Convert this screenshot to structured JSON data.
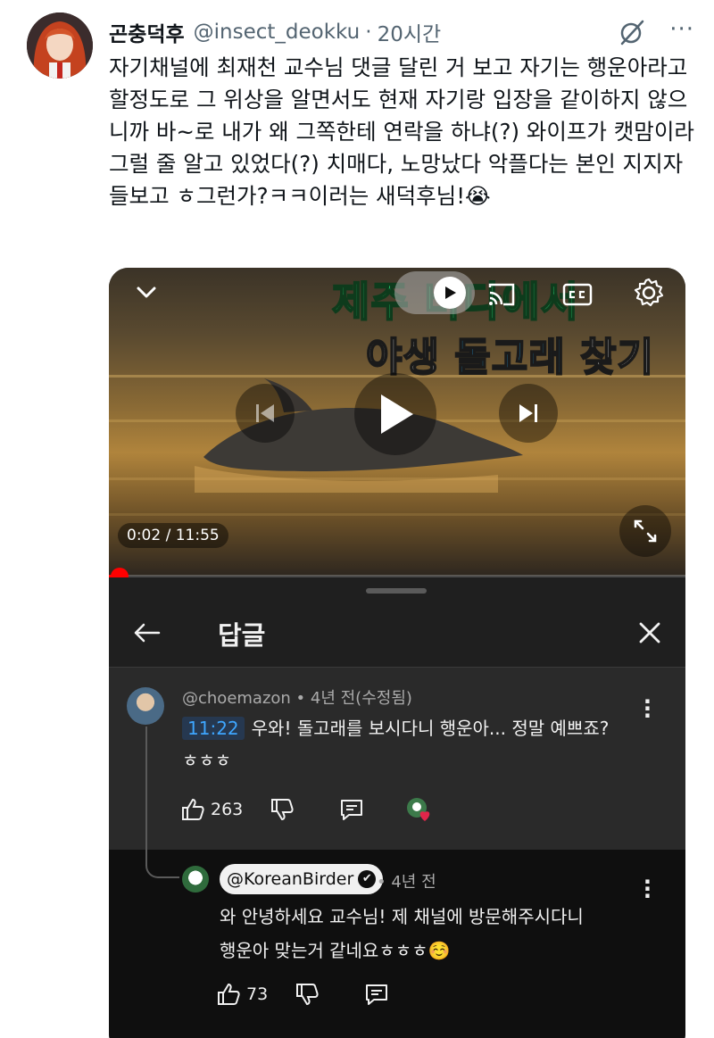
{
  "tweet": {
    "display_name": "곤충덕후",
    "handle": "@insect_deokku",
    "separator": "·",
    "time": "20시간",
    "more": "···",
    "text": "자기채널에 최재천 교수님 댓글 달린 거 보고 자기는 행운아라고 할정도로 그 위상을 알면서도 현재 자기랑 입장을 같이하지 않으니까 바~로 내가 왜 그쪽한테 연락을 하냐(?) 와이프가 캣맘이라 그럴 줄 알고 있었다(?) 치매다, 노망났다 악플다는 본인 지지자들보고 ㅎ그런가?ㅋㅋ이러는 새덕후님!😭"
  },
  "video": {
    "title_line1": "제주 바다에서",
    "title_line2_prefix": "야생 ",
    "title_line2_highlight": "돌고래",
    "title_line2_suffix": " 찾기",
    "current_time": "0:02 / 11:55",
    "progress_fraction": 0.003,
    "icons": [
      "chevron-down-icon",
      "play-icon",
      "cast-icon",
      "captions-icon",
      "settings-icon",
      "previous-icon",
      "next-icon",
      "fullscreen-icon"
    ]
  },
  "replies_sheet": {
    "title": "답글",
    "comment": {
      "author": "@choemazon • 4년 전(수정됨)",
      "timestamp": "11:22",
      "text_line1": "우와! 돌고래를 보시다니 행운아... 정말 예쁘죠?",
      "text_line2": "ㅎㅎㅎ",
      "likes": "263"
    },
    "reply": {
      "mention": "@KoreanBirder",
      "verified_mark": "✔",
      "time": "• 4년 전",
      "text_line1": "와 안녕하세요 교수님! 제 채널에 방문해주시다니",
      "text_line2": "행운아 맞는거 같네요ㅎㅎㅎ☺️",
      "likes": "73"
    }
  }
}
